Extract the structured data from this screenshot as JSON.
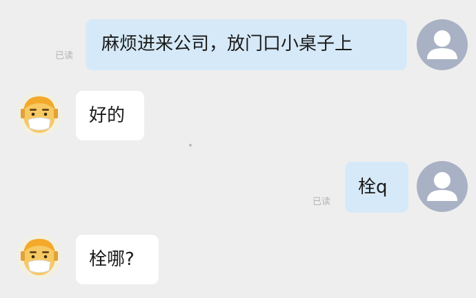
{
  "messages": [
    {
      "side": "sent",
      "text": "麻烦进来公司，放门口小桌子上",
      "status": "已读"
    },
    {
      "side": "received",
      "text": "好的"
    },
    {
      "side": "sent",
      "text": "栓q",
      "status": "已读"
    },
    {
      "side": "received",
      "text": "栓哪?"
    }
  ],
  "avatars": {
    "self": "user-avatar-icon",
    "contact": "masked-character-avatar-icon"
  },
  "colors": {
    "background": "#eeeeee",
    "sent_bubble": "#d6e9f8",
    "received_bubble": "#ffffff",
    "self_avatar": "#a9b1c4",
    "read_text": "#b3b3b3"
  }
}
